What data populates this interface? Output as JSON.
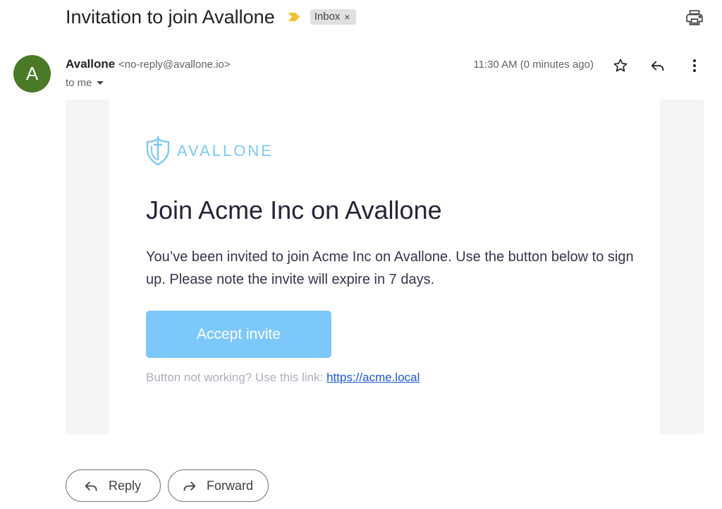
{
  "email": {
    "subject": "Invitation to join Avallone",
    "label": "Inbox",
    "label_close": "×",
    "sender_initial": "A",
    "sender_name": "Avallone",
    "sender_email": "<no-reply@avallone.io>",
    "recipient": "to me",
    "timestamp": "11:30 AM (0 minutes ago)"
  },
  "content": {
    "brand": "AVALLONE",
    "title": "Join Acme Inc on Avallone",
    "body": "You’ve been invited to join Acme Inc on Avallone. Use the button below to sign up. Please note the invite will expire in 7 days.",
    "button": "Accept invite",
    "fallback_text": "Button not working? Use this link:",
    "fallback_link": "https://acme.local"
  },
  "actions": {
    "reply": "Reply",
    "forward": "Forward"
  },
  "icons": {
    "importance": "importance-marker-icon",
    "print": "print-icon",
    "star": "star-icon",
    "reply": "reply-icon",
    "more": "more-vertical-icon",
    "dropdown": "caret-down-icon",
    "logo": "shield-sword-logo-icon",
    "forward": "forward-icon"
  },
  "colors": {
    "avatar": "#4a7a25",
    "brand": "#7dc9f4",
    "button": "#7dc8fa",
    "importance": "#f2c230",
    "link": "#1a56d6"
  }
}
